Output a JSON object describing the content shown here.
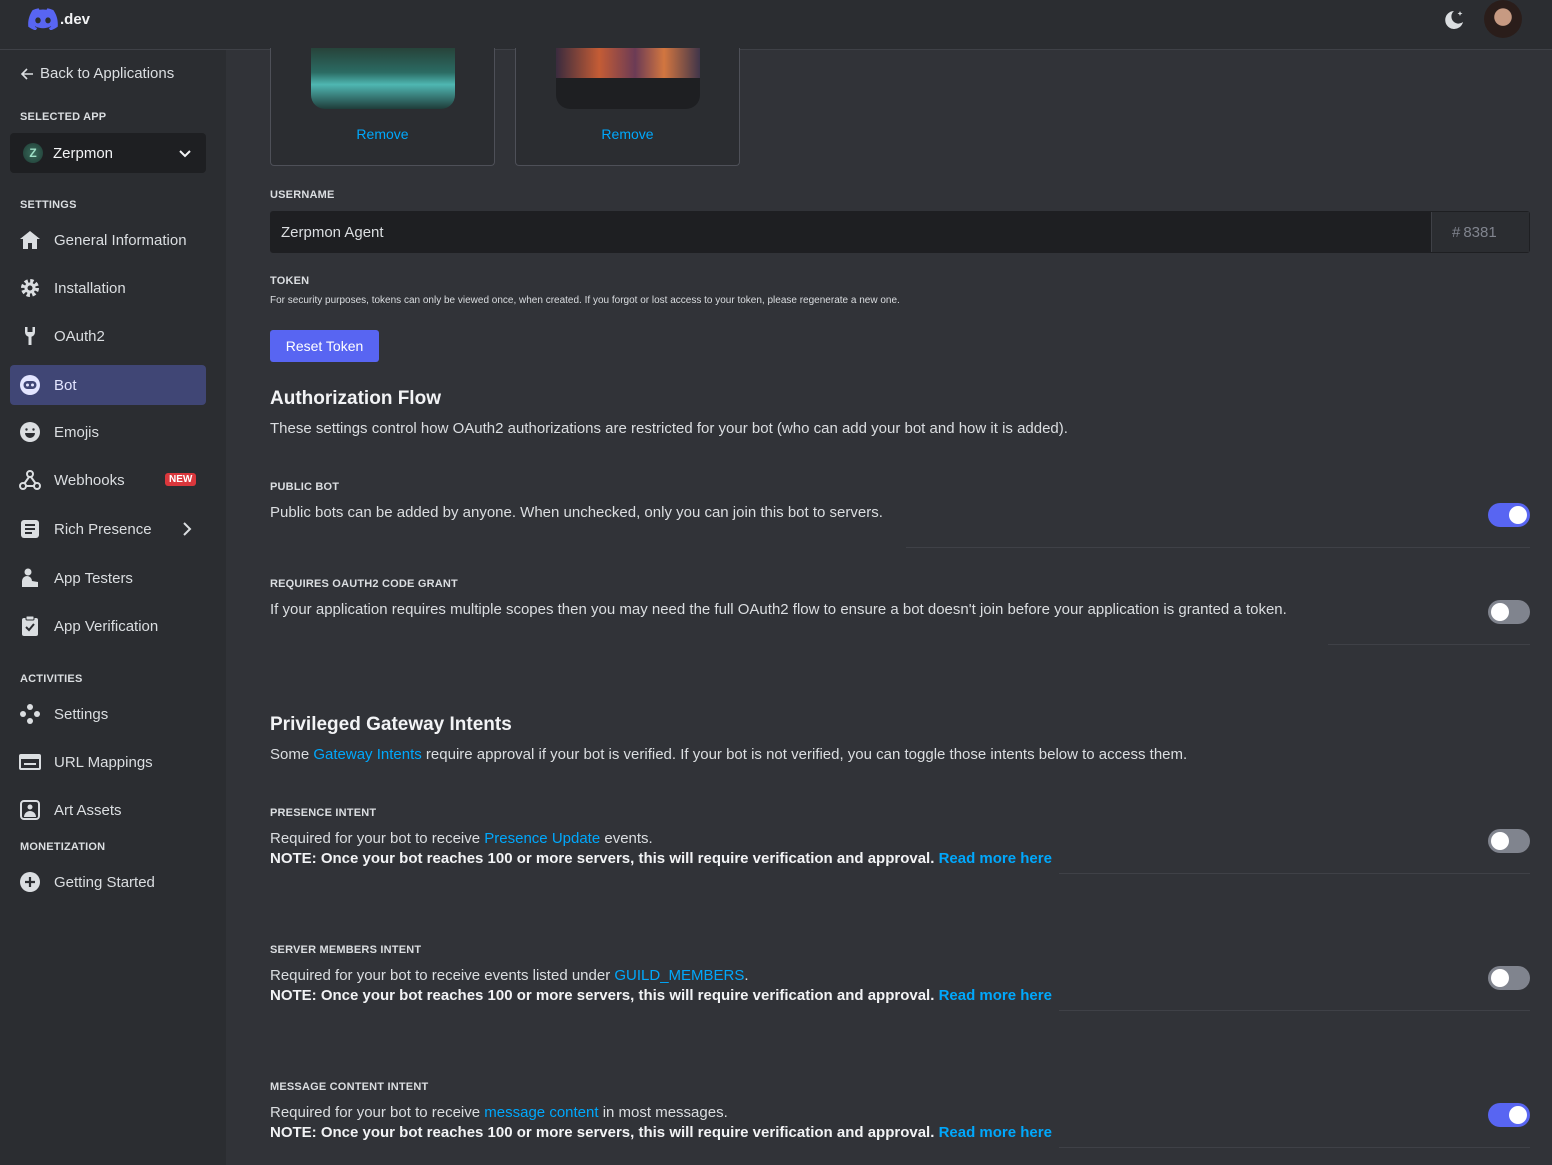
{
  "topbar": {
    "logo_text": ".dev"
  },
  "sidebar": {
    "back_label": "Back to Applications",
    "selected_app_label": "SELECTED APP",
    "app_name": "Zerpmon",
    "settings_label": "SETTINGS",
    "settings_items": [
      {
        "label": "General Information",
        "icon": "home-icon"
      },
      {
        "label": "Installation",
        "icon": "gear-icon"
      },
      {
        "label": "OAuth2",
        "icon": "wrench-icon"
      },
      {
        "label": "Bot",
        "icon": "robot-icon",
        "active": true
      },
      {
        "label": "Emojis",
        "icon": "smiley-icon"
      },
      {
        "label": "Webhooks",
        "icon": "webhook-icon",
        "badge": "NEW"
      },
      {
        "label": "Rich Presence",
        "icon": "document-icon"
      },
      {
        "label": "App Testers",
        "icon": "person-icon"
      },
      {
        "label": "App Verification",
        "icon": "clipboard-check-icon"
      }
    ],
    "activities_label": "ACTIVITIES",
    "activities_items": [
      {
        "label": "Settings",
        "icon": "gamepad-icon"
      },
      {
        "label": "URL Mappings",
        "icon": "browser-icon"
      },
      {
        "label": "Art Assets",
        "icon": "image-icon"
      }
    ],
    "monetization_label": "MONETIZATION",
    "monetization_items": [
      {
        "label": "Getting Started",
        "icon": "plus-circle-icon"
      }
    ]
  },
  "main": {
    "remove_label": "Remove",
    "username_label": "USERNAME",
    "username_value": "Zerpmon Agent",
    "discriminator_hash": "#",
    "discriminator": "8381",
    "token_label": "TOKEN",
    "token_desc": "For security purposes, tokens can only be viewed once, when created. If you forgot or lost access to your token, please regenerate a new one.",
    "reset_token_label": "Reset Token",
    "auth_flow": {
      "title": "Authorization Flow",
      "desc": "These settings control how OAuth2 authorizations are restricted for your bot (who can add your bot and how it is added).",
      "public_bot_label": "PUBLIC BOT",
      "public_bot_desc": "Public bots can be added by anyone. When unchecked, only you can join this bot to servers.",
      "public_bot_on": true,
      "code_grant_label": "REQUIRES OAUTH2 CODE GRANT",
      "code_grant_desc": "If your application requires multiple scopes then you may need the full OAuth2 flow to ensure a bot doesn't join before your application is granted a token.",
      "code_grant_on": false
    },
    "intents": {
      "title": "Privileged Gateway Intents",
      "desc_pre": "Some ",
      "desc_link": "Gateway Intents",
      "desc_post": " require approval if your bot is verified. If your bot is not verified, you can toggle those intents below to access them.",
      "note": "NOTE: Once your bot reaches 100 or more servers, this will require verification and approval.",
      "read_more": "Read more here",
      "presence": {
        "label": "PRESENCE INTENT",
        "pre": "Required for your bot to receive ",
        "link": "Presence Update",
        "post": " events.",
        "on": false
      },
      "members": {
        "label": "SERVER MEMBERS INTENT",
        "pre": "Required for your bot to receive events listed under ",
        "link": "GUILD_MEMBERS",
        "post": ".",
        "on": false
      },
      "message": {
        "label": "MESSAGE CONTENT INTENT",
        "pre": "Required for your bot to receive ",
        "link": "message content",
        "post": " in most messages.",
        "on": true
      }
    }
  },
  "colors": {
    "accent": "#5865f2",
    "link": "#00a8fc",
    "bg": "#313338",
    "sidebar": "#2b2d31"
  }
}
